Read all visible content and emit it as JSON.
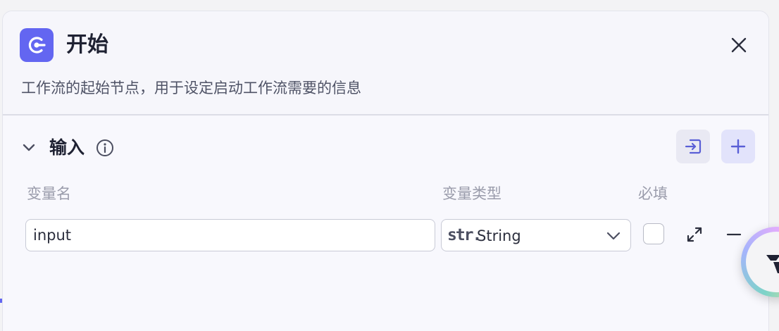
{
  "panel": {
    "title": "开始",
    "description": "工作流的起始节点，用于设定启动工作流需要的信息",
    "icon": "start-node-icon",
    "accent": "#6366f1"
  },
  "input_section": {
    "title": "输入",
    "columns": {
      "name": "变量名",
      "type": "变量类型",
      "required": "必填"
    },
    "rows": [
      {
        "name": "input",
        "type_prefix": "str.",
        "type": "String",
        "required": false
      }
    ]
  },
  "icons": {
    "close": "close-icon",
    "collapse": "chevron-down-icon",
    "info": "info-icon",
    "import": "import-icon",
    "add": "plus-icon",
    "expand": "expand-icon",
    "remove": "minus-icon",
    "assistant": "assistant-logo-icon"
  }
}
